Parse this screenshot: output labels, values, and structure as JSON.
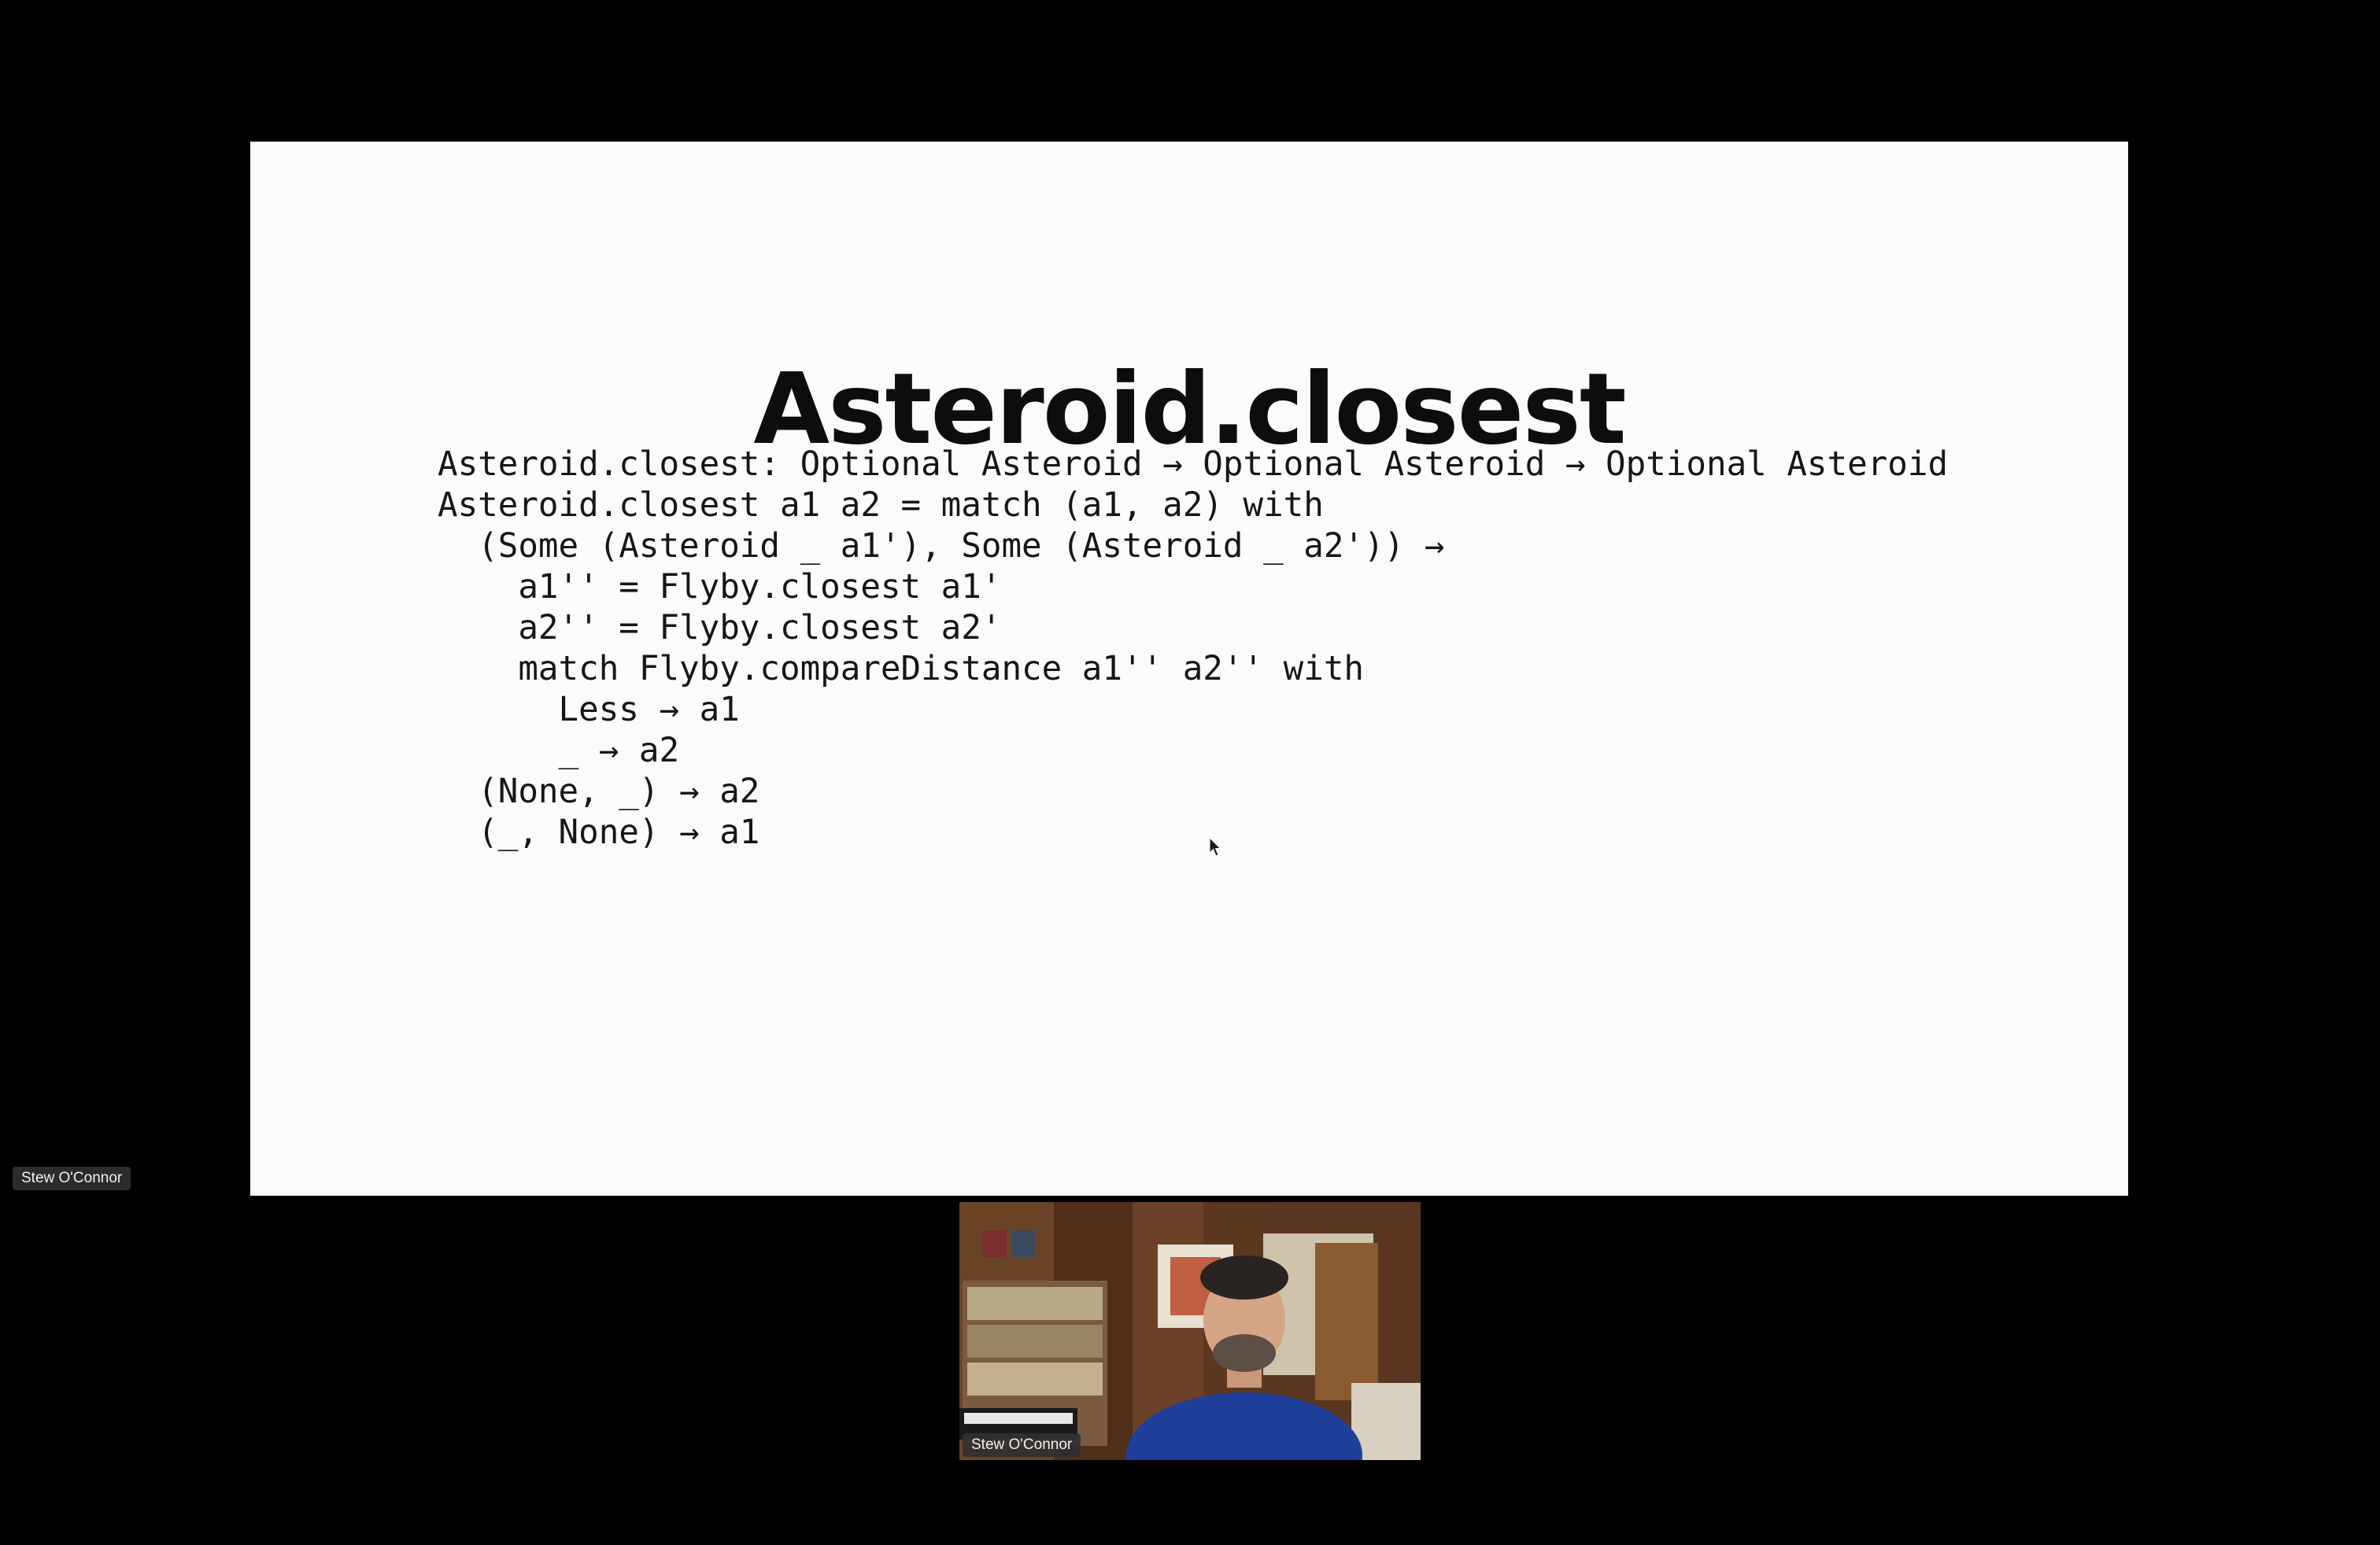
{
  "participant_side_label": "Stew O'Connor",
  "slide": {
    "title": "Asteroid.closest",
    "code_lines": [
      "Asteroid.closest: Optional Asteroid → Optional Asteroid → Optional Asteroid",
      "Asteroid.closest a1 a2 = match (a1, a2) with",
      "  (Some (Asteroid _ a1'), Some (Asteroid _ a2')) →",
      "    a1'' = Flyby.closest a1'",
      "    a2'' = Flyby.closest a2'",
      "    match Flyby.compareDistance a1'' a2'' with",
      "      Less → a1",
      "      _ → a2",
      "  (None, _) → a2",
      "  (_, None) → a1"
    ]
  },
  "video": {
    "participant_name": "Stew O'Connor"
  }
}
